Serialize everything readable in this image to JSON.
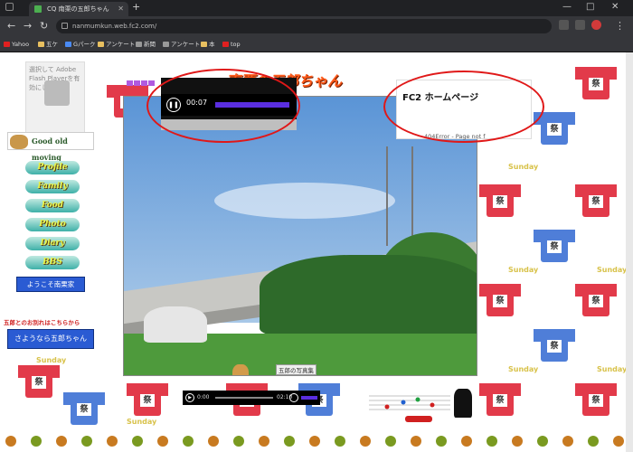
{
  "browser": {
    "tab_title": "CQ 南栗の五郎ちゃん",
    "url": "nanmumkun.web.fc2.com/",
    "window_controls": [
      "—",
      "□",
      "✕"
    ],
    "bookmarks": [
      {
        "label": "Yahoo",
        "icon": "yahoo-icon",
        "color": "#e02020"
      },
      {
        "label": "五ケ",
        "icon": "folder-icon",
        "color": "#e8c060"
      },
      {
        "label": "Gパーク",
        "icon": "google-icon",
        "color": "#4a8af4"
      },
      {
        "label": "アンケート",
        "icon": "folder-icon",
        "color": "#e8c060"
      },
      {
        "label": "新聞",
        "icon": "star-icon",
        "color": "#999999"
      },
      {
        "label": "アンケート",
        "icon": "star-icon",
        "color": "#999999"
      },
      {
        "label": "本",
        "icon": "folder-icon",
        "color": "#e8c060"
      },
      {
        "label": "top",
        "icon": "page-icon",
        "color": "#e02020"
      }
    ]
  },
  "sidebar": {
    "flash_notice": "選択して Adobe Flash Playerを有効にします",
    "good_old": "Good old moving",
    "menu": [
      "Profile",
      "Family",
      "Food",
      "Photo",
      "Diary",
      "BBS"
    ],
    "welcome_button": "ようこそ南栗家",
    "red_note": "五郎とのお別れはこちらから",
    "goodbye_button": "さようなら五郎ちゃん"
  },
  "main": {
    "site_title": "南栗の五郎ちゃん",
    "photo_caption": "五郎の写真集",
    "audio_top": {
      "time": "00:07",
      "state": "playing"
    },
    "fc2_title": "FC2 ホームページ",
    "fc2_error": "404Error - Page not f",
    "audio_bottom": {
      "current": "0:00",
      "duration": "02:10"
    },
    "background_word": "Sunday",
    "background_char": "祭"
  },
  "colors": {
    "accent_purple": "#5a2ee0",
    "highlight_red": "#e01818",
    "title_orange": "#ff5a1a"
  }
}
